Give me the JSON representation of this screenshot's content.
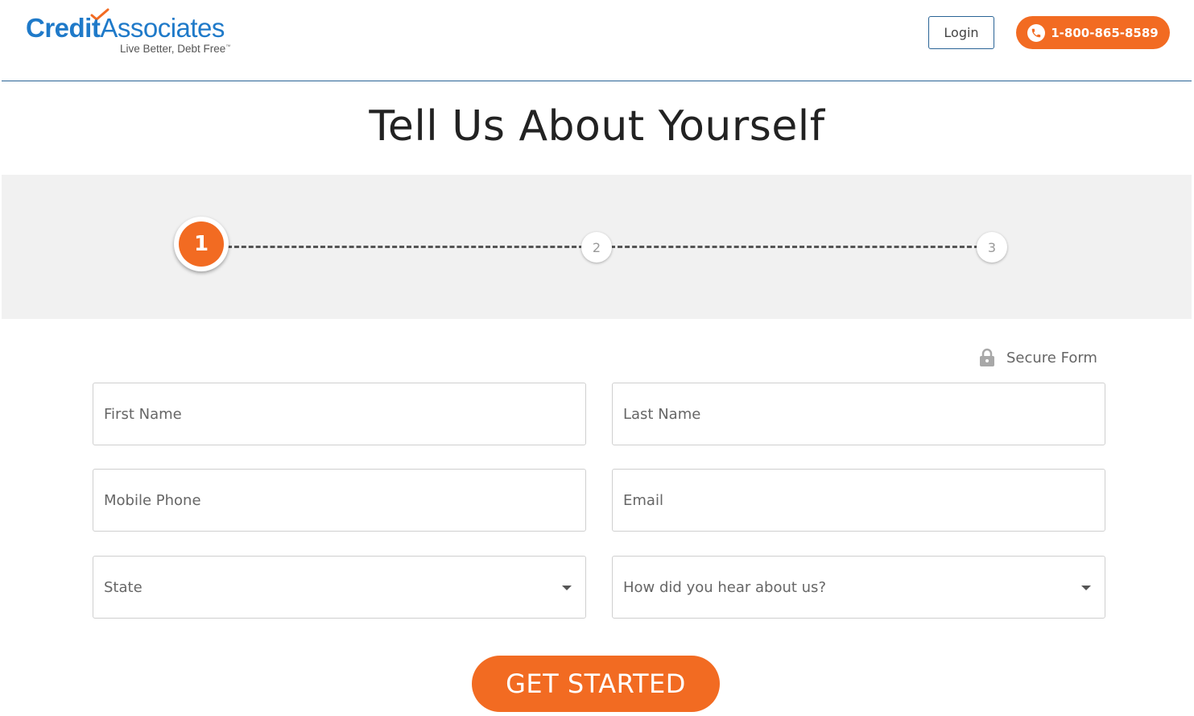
{
  "brand": {
    "name_bold": "Credit",
    "name_rest": "Associates",
    "tagline": "Live Better, Debt Free",
    "trademark": "™",
    "accent": "#f26b22",
    "primary": "#1f7ac9"
  },
  "header": {
    "login_label": "Login",
    "phone_label": "1-800-865-8589",
    "phone_icon": "phone-icon"
  },
  "page": {
    "title": "Tell Us About Yourself"
  },
  "stepper": {
    "current": "1",
    "steps": [
      "1",
      "2",
      "3"
    ]
  },
  "secure": {
    "label": "Secure Form",
    "icon": "lock-icon"
  },
  "form": {
    "first_name": "First Name",
    "last_name": "Last Name",
    "mobile_phone": "Mobile Phone",
    "email": "Email",
    "state": "State",
    "referral": "How did you hear about us?",
    "submit_label": "GET STARTED"
  }
}
